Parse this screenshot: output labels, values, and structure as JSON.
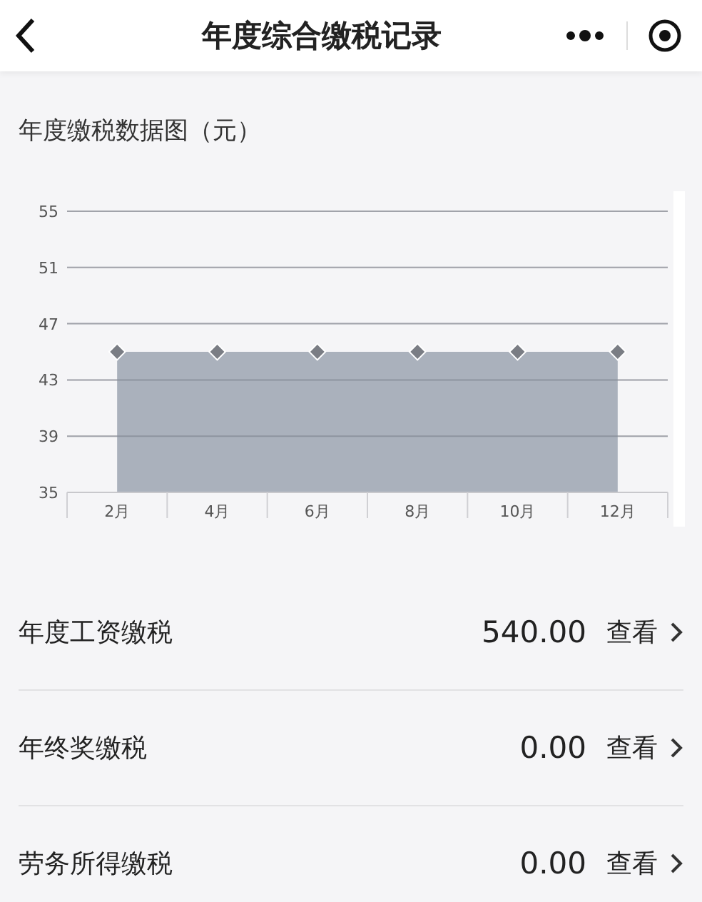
{
  "header": {
    "title": "年度综合缴税记录"
  },
  "chart_section": {
    "title": "年度缴税数据图（元）",
    "chart_data": {
      "type": "area",
      "categories": [
        "2月",
        "4月",
        "6月",
        "8月",
        "10月",
        "12月"
      ],
      "grid": true,
      "series": [
        {
          "color": "#aab1bc",
          "values": [
            45,
            45,
            45,
            45,
            45,
            45
          ]
        }
      ],
      "ylim": [
        35,
        55
      ],
      "yticks": [
        35,
        39,
        43,
        47,
        51,
        55
      ]
    }
  },
  "rows": [
    {
      "label": "年度工资缴税",
      "amount": "540.00",
      "action": "查看"
    },
    {
      "label": "年终奖缴税",
      "amount": "0.00",
      "action": "查看"
    },
    {
      "label": "劳务所得缴税",
      "amount": "0.00",
      "action": "查看"
    }
  ]
}
